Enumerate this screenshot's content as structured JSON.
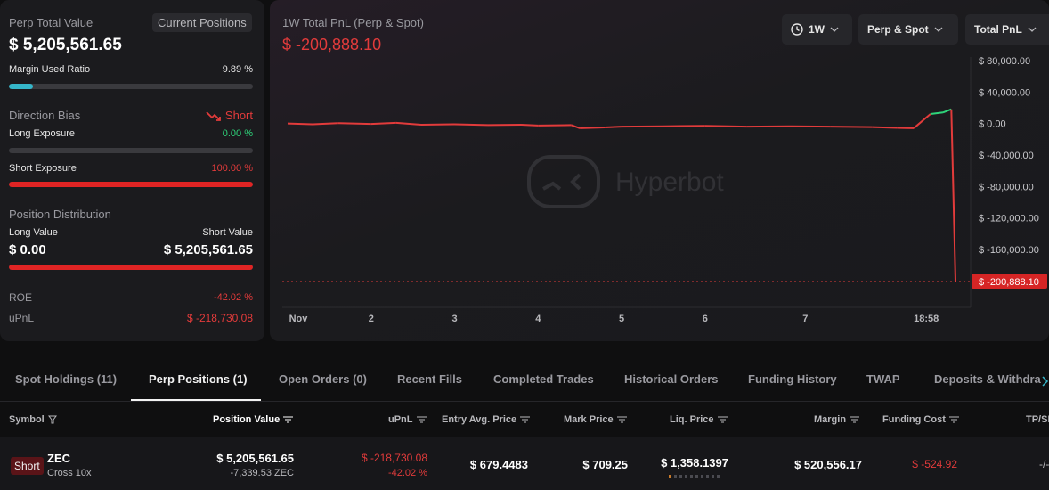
{
  "left": {
    "perp_total_label": "Perp Total Value",
    "current_positions_btn": "Current Positions",
    "perp_total_value": "$ 5,205,561.65",
    "margin_used_label": "Margin Used Ratio",
    "margin_used_value": "9.89 %",
    "margin_used_fraction": 0.0989,
    "direction_bias_label": "Direction Bias",
    "direction_bias_value": "Short",
    "long_exposure_label": "Long Exposure",
    "long_exposure_value": "0.00 %",
    "long_exposure_fraction": 0,
    "short_exposure_label": "Short Exposure",
    "short_exposure_value": "100.00 %",
    "short_exposure_fraction": 1.0,
    "position_distribution_label": "Position Distribution",
    "long_value_label": "Long Value",
    "short_value_label": "Short Value",
    "long_value": "$ 0.00",
    "short_value": "$ 5,205,561.65",
    "roe_label": "ROE",
    "roe_value": "-42.02 %",
    "upnl_label": "uPnL",
    "upnl_value": "$ -218,730.08"
  },
  "chart": {
    "title": "1W Total PnL (Perp & Spot)",
    "value": "$ -200,888.10",
    "watermark": "Hyperbot",
    "range_btn": "1W",
    "scope_btn": "Perp & Spot",
    "metric_btn": "Total PnL",
    "current_label": "$ -200,888.10"
  },
  "chart_data": {
    "type": "line",
    "x_ticks": [
      "Nov",
      "2",
      "3",
      "4",
      "5",
      "6",
      "7",
      "18:58"
    ],
    "y_ticks": [
      "$ 80,000.00",
      "$ 40,000.00",
      "$ 0.00",
      "$ -40,000.00",
      "$ -80,000.00",
      "$ -120,000.00",
      "$ -160,000.00"
    ],
    "ylim": [
      -200888.1,
      80000
    ],
    "x": [
      0,
      0.3,
      0.6,
      1,
      1.3,
      1.6,
      2,
      2.4,
      2.8,
      3,
      3.4,
      3.5,
      3.8,
      4,
      4.5,
      5,
      5.5,
      6,
      6.5,
      7,
      7.3,
      7.5,
      7.7,
      7.85,
      7.95,
      8.0
    ],
    "y": [
      0,
      -1000,
      500,
      -500,
      800,
      -1500,
      -1000,
      -2000,
      -1500,
      -2500,
      -2000,
      -6000,
      -5000,
      -4000,
      -3500,
      -3000,
      -4000,
      -3500,
      -4000,
      -4500,
      -5500,
      -6000,
      12000,
      14000,
      18000,
      -200888.1
    ],
    "colors": {
      "positive": "#2ed47a",
      "negative": "#e23b3b"
    }
  },
  "tabs": [
    {
      "label": "Spot Holdings (11)"
    },
    {
      "label": "Perp Positions (1)"
    },
    {
      "label": "Open Orders (0)"
    },
    {
      "label": "Recent Fills"
    },
    {
      "label": "Completed Trades"
    },
    {
      "label": "Historical Orders"
    },
    {
      "label": "Funding History"
    },
    {
      "label": "TWAP"
    },
    {
      "label": "Deposits & Withdra"
    }
  ],
  "table": {
    "headers": {
      "symbol": "Symbol",
      "position_value": "Position Value",
      "upnl": "uPnL",
      "entry": "Entry Avg. Price",
      "mark": "Mark Price",
      "liq": "Liq. Price",
      "margin": "Margin",
      "funding": "Funding Cost",
      "tpsl": "TP/SL"
    },
    "row": {
      "side": "Short",
      "symbol": "ZEC",
      "leverage": "Cross 10x",
      "position_value": "$ 5,205,561.65",
      "position_size": "-7,339.53 ZEC",
      "upnl": "$ -218,730.08",
      "upnl_pct": "-42.02 %",
      "entry": "$ 679.4483",
      "mark": "$ 709.25",
      "liq": "$ 1,358.1397",
      "margin": "$ 520,556.17",
      "funding": "$ -524.92",
      "tpsl": "-/-"
    }
  }
}
